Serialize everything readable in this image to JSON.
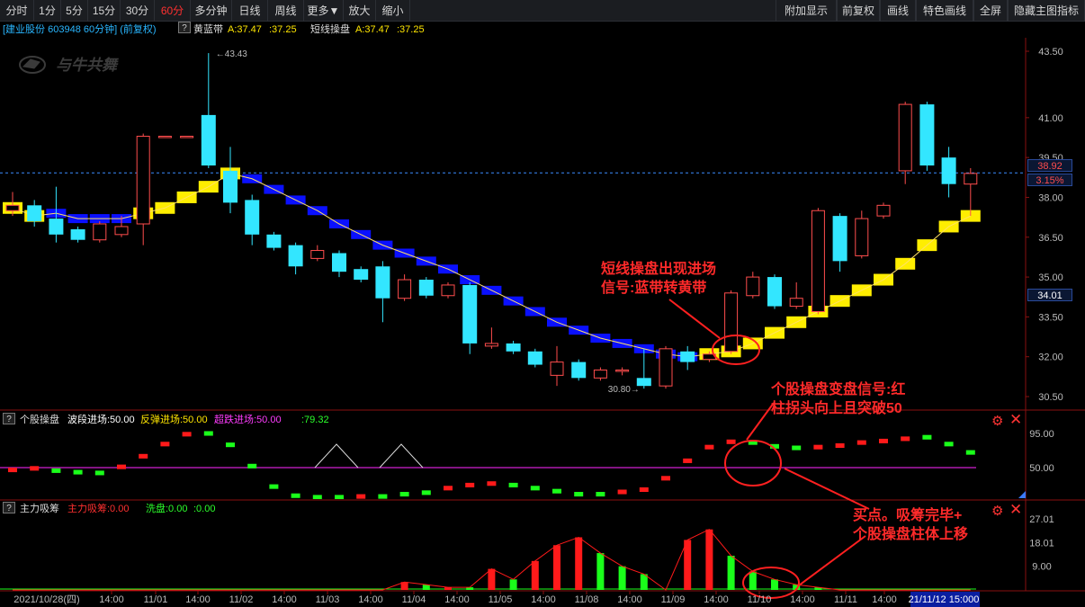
{
  "toolbar": {
    "left": [
      "分时",
      "1分",
      "5分",
      "15分",
      "30分",
      "60分",
      "多分钟",
      "日线",
      "周线",
      "更多▼",
      "放大",
      "缩小"
    ],
    "active": "60分",
    "right": [
      "附加显示",
      "前复权",
      "画线",
      "特色画线",
      "全屏",
      "隐藏主图指标"
    ]
  },
  "header": {
    "stock": "[建业股份 603948 60分钟] (前复权)",
    "q": "?",
    "ind1_name": "黄蓝带",
    "ind1_a": "A:37.47",
    "ind1_b": ":37.25",
    "ind2_name": "短线操盘",
    "ind2_a": "A:37.47",
    "ind2_b": ":37.25"
  },
  "logo": "与牛共舞",
  "price_axis": [
    "43.50",
    "41.00",
    "39.50",
    "38.00",
    "36.50",
    "35.00",
    "33.50",
    "32.00",
    "30.50"
  ],
  "current_price": "38.92",
  "change_pct": "3.15%",
  "cursor_price": "34.01",
  "hi_label": "43.43",
  "lo_label": "30.80",
  "ind_panel": {
    "q": "?",
    "name": "个股操盘",
    "f1": "波段进场:50.00",
    "f2": "反弹进场:50.00",
    "f3": "超跌进场:50.00",
    "f4": ":79.32",
    "axis": [
      "95.00",
      "50.00"
    ]
  },
  "vol_panel": {
    "q": "?",
    "name": "主力吸筹",
    "f1": "主力吸筹:0.00",
    "f2": "洗盘:0.00",
    "f3": ":0.00",
    "axis": [
      "27.01",
      "18.01",
      "9.00"
    ]
  },
  "time_axis": [
    "2021/10/28(四)",
    "14:00",
    "11/01",
    "14:00",
    "11/02",
    "14:00",
    "11/03",
    "14:00",
    "11/04",
    "14:00",
    "11/05",
    "14:00",
    "11/08",
    "14:00",
    "11/09",
    "14:00",
    "11/10",
    "14:00",
    "11/11",
    "14:00",
    "21/11/12 15:000"
  ],
  "annotations": {
    "a1": [
      "短线操盘出现进场",
      "信号:蓝带转黄带"
    ],
    "a2": [
      "个股操盘变盘信号:红",
      "柱拐头向上且突破50"
    ],
    "a3": [
      "买点。吸筹完毕+",
      "个股操盘柱体上移"
    ]
  },
  "chart_data": {
    "type": "candlestick",
    "ylim": [
      30.2,
      43.9
    ],
    "candles": [
      {
        "o": 37.5,
        "c": 37.7,
        "h": 38.2,
        "l": 37.3,
        "up": true
      },
      {
        "o": 37.7,
        "c": 37.1,
        "h": 37.9,
        "l": 36.9,
        "up": false
      },
      {
        "o": 37.2,
        "c": 36.6,
        "h": 38.4,
        "l": 36.3,
        "up": false
      },
      {
        "o": 36.8,
        "c": 36.4,
        "h": 36.9,
        "l": 36.3,
        "up": false
      },
      {
        "o": 36.4,
        "c": 37.0,
        "h": 37.1,
        "l": 36.3,
        "up": true
      },
      {
        "o": 36.6,
        "c": 36.9,
        "h": 37.3,
        "l": 36.5,
        "up": true
      },
      {
        "o": 37.0,
        "c": 40.3,
        "h": 40.4,
        "l": 36.2,
        "up": true
      },
      {
        "o": 40.3,
        "c": 40.3,
        "h": 40.3,
        "l": 40.3,
        "up": true
      },
      {
        "o": 40.3,
        "c": 40.3,
        "h": 40.3,
        "l": 40.3,
        "up": true
      },
      {
        "o": 41.1,
        "c": 39.2,
        "h": 43.43,
        "l": 39.1,
        "up": false
      },
      {
        "o": 39.0,
        "c": 37.8,
        "h": 39.9,
        "l": 37.4,
        "up": false
      },
      {
        "o": 37.9,
        "c": 36.6,
        "h": 38.1,
        "l": 36.2,
        "up": false
      },
      {
        "o": 36.6,
        "c": 36.1,
        "h": 36.7,
        "l": 36.0,
        "up": false
      },
      {
        "o": 36.2,
        "c": 35.4,
        "h": 36.3,
        "l": 35.1,
        "up": false
      },
      {
        "o": 35.7,
        "c": 36.0,
        "h": 36.2,
        "l": 35.6,
        "up": true
      },
      {
        "o": 35.9,
        "c": 35.2,
        "h": 36.0,
        "l": 35.0,
        "up": false
      },
      {
        "o": 35.3,
        "c": 34.9,
        "h": 35.4,
        "l": 34.8,
        "up": false
      },
      {
        "o": 35.4,
        "c": 34.2,
        "h": 35.6,
        "l": 33.3,
        "up": false
      },
      {
        "o": 34.2,
        "c": 34.9,
        "h": 35.1,
        "l": 34.1,
        "up": true
      },
      {
        "o": 34.9,
        "c": 34.3,
        "h": 35.0,
        "l": 34.2,
        "up": false
      },
      {
        "o": 34.3,
        "c": 34.7,
        "h": 34.8,
        "l": 34.2,
        "up": true
      },
      {
        "o": 34.7,
        "c": 32.5,
        "h": 34.8,
        "l": 32.1,
        "up": false
      },
      {
        "o": 32.4,
        "c": 32.5,
        "h": 33.1,
        "l": 32.3,
        "up": true
      },
      {
        "o": 32.5,
        "c": 32.2,
        "h": 32.6,
        "l": 32.1,
        "up": false
      },
      {
        "o": 32.2,
        "c": 31.7,
        "h": 32.3,
        "l": 31.6,
        "up": false
      },
      {
        "o": 31.3,
        "c": 31.8,
        "h": 32.4,
        "l": 30.9,
        "up": true
      },
      {
        "o": 31.8,
        "c": 31.2,
        "h": 31.9,
        "l": 31.1,
        "up": false
      },
      {
        "o": 31.2,
        "c": 31.5,
        "h": 31.6,
        "l": 31.1,
        "up": true
      },
      {
        "o": 31.5,
        "c": 31.5,
        "h": 31.6,
        "l": 31.3,
        "up": true
      },
      {
        "o": 31.2,
        "c": 30.9,
        "h": 32.3,
        "l": 30.8,
        "up": false
      },
      {
        "o": 30.9,
        "c": 32.3,
        "h": 32.4,
        "l": 30.8,
        "up": true
      },
      {
        "o": 32.2,
        "c": 31.8,
        "h": 32.4,
        "l": 31.5,
        "up": false
      },
      {
        "o": 31.9,
        "c": 32.1,
        "h": 32.2,
        "l": 31.8,
        "up": true
      },
      {
        "o": 32.2,
        "c": 34.4,
        "h": 34.5,
        "l": 32.1,
        "up": true
      },
      {
        "o": 34.3,
        "c": 35.0,
        "h": 35.2,
        "l": 34.2,
        "up": true
      },
      {
        "o": 35.0,
        "c": 33.9,
        "h": 35.1,
        "l": 33.8,
        "up": false
      },
      {
        "o": 33.9,
        "c": 34.2,
        "h": 34.8,
        "l": 33.8,
        "up": true
      },
      {
        "o": 33.7,
        "c": 37.5,
        "h": 37.6,
        "l": 33.6,
        "up": true
      },
      {
        "o": 37.3,
        "c": 35.6,
        "h": 37.4,
        "l": 35.2,
        "up": false
      },
      {
        "o": 35.8,
        "c": 37.2,
        "h": 37.5,
        "l": 35.7,
        "up": true
      },
      {
        "o": 37.3,
        "c": 37.7,
        "h": 37.8,
        "l": 37.2,
        "up": true
      },
      {
        "o": 39.0,
        "c": 41.5,
        "h": 41.6,
        "l": 38.5,
        "up": true
      },
      {
        "o": 41.5,
        "c": 39.2,
        "h": 41.6,
        "l": 39.0,
        "up": false
      },
      {
        "o": 39.5,
        "c": 38.5,
        "h": 39.9,
        "l": 38.0,
        "up": false
      },
      {
        "o": 38.5,
        "c": 38.9,
        "h": 39.1,
        "l": 37.3,
        "up": true
      }
    ],
    "band": [
      37.6,
      37.3,
      37.4,
      37.2,
      37.2,
      37.2,
      37.4,
      37.6,
      38.0,
      38.4,
      38.9,
      38.7,
      38.3,
      37.9,
      37.5,
      37.0,
      36.6,
      36.2,
      35.9,
      35.6,
      35.3,
      34.9,
      34.5,
      34.1,
      33.7,
      33.3,
      33.0,
      32.7,
      32.5,
      32.3,
      32.1,
      32.0,
      32.1,
      32.2,
      32.5,
      32.9,
      33.3,
      33.7,
      34.1,
      34.5,
      34.9,
      35.5,
      36.2,
      36.9,
      37.3
    ],
    "band_type": [
      "y",
      "y",
      "b",
      "b",
      "b",
      "b",
      "y",
      "y",
      "y",
      "y",
      "y",
      "b",
      "b",
      "b",
      "b",
      "b",
      "b",
      "b",
      "b",
      "b",
      "b",
      "b",
      "b",
      "b",
      "b",
      "b",
      "b",
      "b",
      "b",
      "b",
      "b",
      "b",
      "y",
      "y",
      "y",
      "y",
      "y",
      "y",
      "y",
      "y",
      "y",
      "y",
      "y",
      "y",
      "y"
    ],
    "ind_bars": [
      50,
      52,
      49,
      47,
      46,
      54,
      68,
      84,
      97,
      98,
      83,
      55,
      28,
      16,
      14,
      14,
      15,
      15,
      18,
      20,
      26,
      30,
      32,
      30,
      26,
      22,
      18,
      18,
      21,
      24,
      39,
      62,
      80,
      87,
      86,
      81,
      79,
      80,
      82,
      86,
      88,
      91,
      93,
      84,
      73
    ],
    "ind_up": [
      true,
      true,
      false,
      false,
      false,
      true,
      true,
      true,
      true,
      false,
      false,
      false,
      false,
      false,
      false,
      false,
      true,
      false,
      false,
      false,
      true,
      true,
      true,
      false,
      false,
      false,
      false,
      false,
      true,
      true,
      true,
      true,
      true,
      true,
      false,
      false,
      false,
      true,
      true,
      true,
      true,
      true,
      false,
      false,
      false
    ],
    "vol_bars": [
      0,
      0,
      0,
      0,
      0,
      0,
      0,
      0,
      0,
      0,
      0,
      0,
      0,
      0,
      0,
      0,
      0,
      0,
      3,
      2,
      1,
      1,
      8,
      4,
      11,
      17,
      20,
      14,
      9,
      6,
      0,
      19,
      23,
      13,
      7,
      4,
      2,
      1,
      0,
      0,
      0,
      0,
      0,
      0,
      0
    ],
    "vol_up": [
      true,
      true,
      true,
      true,
      true,
      true,
      true,
      true,
      true,
      true,
      true,
      true,
      true,
      true,
      true,
      true,
      true,
      true,
      true,
      false,
      true,
      false,
      true,
      false,
      true,
      true,
      true,
      false,
      false,
      false,
      true,
      true,
      true,
      false,
      false,
      false,
      false,
      false,
      true,
      true,
      true,
      true,
      true,
      true,
      true
    ],
    "vol_ylim": [
      0,
      29
    ]
  }
}
